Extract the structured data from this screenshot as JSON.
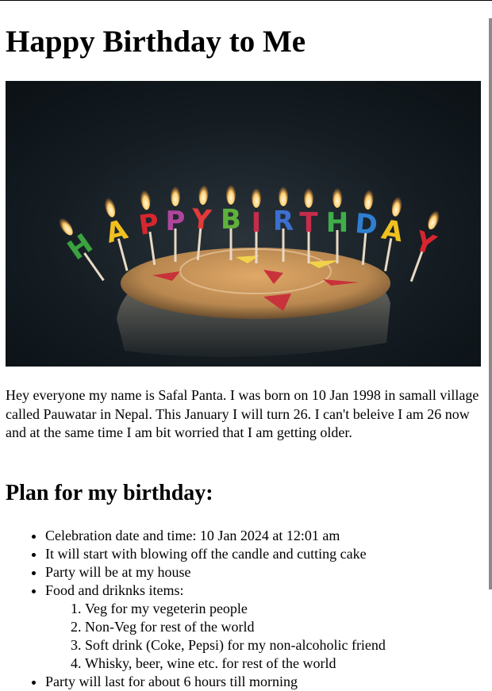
{
  "page": {
    "title": "Happy Birthday to Me",
    "image_alt": "Birthday cake with HAPPY BIRTHDAY candles",
    "candle_letters": [
      "H",
      "A",
      "P",
      "P",
      "Y",
      "B",
      "I",
      "R",
      "T",
      "H",
      "D",
      "A",
      "Y"
    ],
    "intro": "Hey everyone my name is Safal Panta. I was born on 10 Jan 1998 in samall village called Pauwatar in Nepal. This January I will turn 26. I can't beleive I am 26 now and at the same time I am bit worried that I am getting older.",
    "plan_heading": "Plan for my birthday:",
    "plan_items": [
      "Celebration date and time: 10 Jan 2024 at 12:01 am",
      "It will start with blowing off the candle and cutting cake",
      "Party will be at my house",
      "Food and driknks items:"
    ],
    "food_items": [
      "Veg for my vegeterin people",
      "Non-Veg for rest of the world",
      "Soft drink (Coke, Pepsi) for my non-alcoholic friend",
      "Whisky, beer, wine etc. for rest of the world"
    ],
    "last_item": "Party will last for about 6 hours till morning"
  },
  "colors": {
    "photo_bg": "#111a20",
    "cake": "#b8874f",
    "candle_colors": [
      "#3aa23f",
      "#f0c020",
      "#d8262e",
      "#b0469c",
      "#e43a3a",
      "#5fb13b",
      "#c72c4b",
      "#3b6fd1",
      "#c72c4b",
      "#3fae4a",
      "#2e7fd0",
      "#f0c020",
      "#d8262e"
    ]
  }
}
